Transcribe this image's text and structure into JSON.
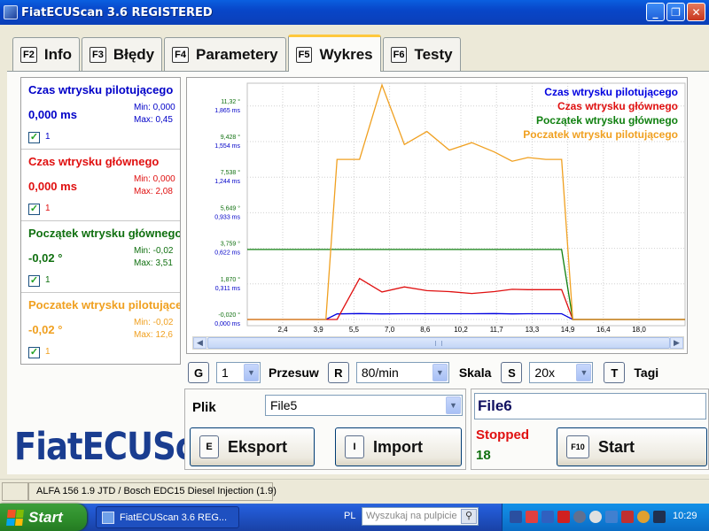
{
  "window": {
    "title": "FiatECUScan 3.6 REGISTERED",
    "buttons": [
      "_",
      "❐",
      "✕"
    ]
  },
  "tabs": [
    {
      "key": "F2",
      "label": "Info"
    },
    {
      "key": "F3",
      "label": "Błędy"
    },
    {
      "key": "F4",
      "label": "Parametery"
    },
    {
      "key": "F5",
      "label": "Wykres",
      "active": true
    },
    {
      "key": "F6",
      "label": "Testy"
    }
  ],
  "channels": [
    {
      "name": "Czas wtrysku pilotującego",
      "value": "0,000 ms",
      "min": "Min: 0,000",
      "max": "Max: 0,45",
      "checked_label": "1",
      "color": "#0000c8"
    },
    {
      "name": "Czas wtrysku głównego",
      "value": "0,000 ms",
      "min": "Min: 0,000",
      "max": "Max: 2,08",
      "checked_label": "1",
      "color": "#e01010"
    },
    {
      "name": "Początek wtrysku głównego",
      "value": "-0,02 °",
      "min": "Min: -0,02",
      "max": "Max: 3,51",
      "checked_label": "1",
      "color": "#107010"
    },
    {
      "name": "Poczatek wtrysku pilotującego",
      "value": "-0,02 °",
      "min": "Min: -0,02",
      "max": "Max: 12,6",
      "checked_label": "1",
      "color": "#f0a020"
    }
  ],
  "logo": "FiatECUScan",
  "chart_data": {
    "type": "line",
    "x": [
      0.0,
      1.4,
      2.4,
      3.5,
      4.0,
      5.0,
      6.0,
      7.0,
      8.0,
      9.0,
      10.0,
      11.0,
      11.8,
      12.5,
      13.3,
      14.0,
      14.5,
      15.5,
      17.0,
      18.5,
      19.5
    ],
    "xticks": [
      "2,4",
      "3,9",
      "5,5",
      "7,0",
      "8,6",
      "10,2",
      "11,7",
      "13,3",
      "14,9",
      "16,4",
      "18,0"
    ],
    "yticks_deg": [
      "-0,020 °",
      "1,870 °",
      "3,759 °",
      "5,649 °",
      "7,538 °",
      "9,428 °",
      "11,32 °"
    ],
    "yticks_ms": [
      "0,000 ms",
      "0,311 ms",
      "0,622 ms",
      "0,933 ms",
      "1,244 ms",
      "1,554 ms",
      "1,865 ms"
    ],
    "series": [
      {
        "name": "Czas wtrysku pilotującego",
        "color": "#0000e0",
        "values": [
          0,
          0,
          0,
          0,
          0.3,
          0.32,
          0.3,
          0.31,
          0.31,
          0.31,
          0.31,
          0.32,
          0.3,
          0.31,
          0.31,
          0.31,
          0,
          0,
          0,
          0,
          0
        ]
      },
      {
        "name": "Czas wtrysku głównego",
        "color": "#e01010",
        "values": [
          0,
          0,
          0,
          0,
          0,
          2.2,
          1.48,
          1.75,
          1.55,
          1.5,
          1.4,
          1.5,
          1.62,
          1.6,
          1.6,
          1.6,
          0,
          0,
          0,
          0,
          0
        ]
      },
      {
        "name": "Początek wtrysku głównego",
        "color": "#108010",
        "values": [
          3.76,
          3.76,
          3.76,
          3.76,
          3.76,
          3.76,
          3.76,
          3.76,
          3.76,
          3.76,
          3.76,
          3.76,
          3.76,
          3.76,
          3.76,
          3.76,
          0,
          0,
          0,
          0,
          0
        ]
      },
      {
        "name": "Poczatek wtrysku pilotującego",
        "color": "#f0a020",
        "values": [
          0,
          0,
          0,
          0,
          8.6,
          8.6,
          12.6,
          9.4,
          10.1,
          9.1,
          9.5,
          9.0,
          8.5,
          8.7,
          8.6,
          8.6,
          0,
          0,
          0,
          0,
          0
        ]
      }
    ]
  },
  "controls": {
    "g_key": "G",
    "g_value": "1",
    "przesuw_label": "Przesuw",
    "r_key": "R",
    "r_value": "80/min",
    "skala_label": "Skala",
    "s_key": "S",
    "s_value": "20x",
    "t_key": "T",
    "tagi_label": "Tagi"
  },
  "file_group": {
    "plik_label": "Plik",
    "plik_value": "File5",
    "eksport_key": "E",
    "eksport_label": "Eksport",
    "import_key": "I",
    "import_label": "Import"
  },
  "record_group": {
    "file_name": "File6",
    "status": "Stopped",
    "count": "18",
    "start_key": "F10",
    "start_label": "Start"
  },
  "statusbar": {
    "vehicle": "ALFA 156 1.9 JTD / Bosch EDC15 Diesel Injection (1.9)"
  },
  "taskbar": {
    "start_label": "Start",
    "task_label": "FiatECUScan 3.6 REG...",
    "lang": "PL",
    "search_placeholder": "Wyszukaj na pulpicie",
    "clock": "10:29"
  }
}
